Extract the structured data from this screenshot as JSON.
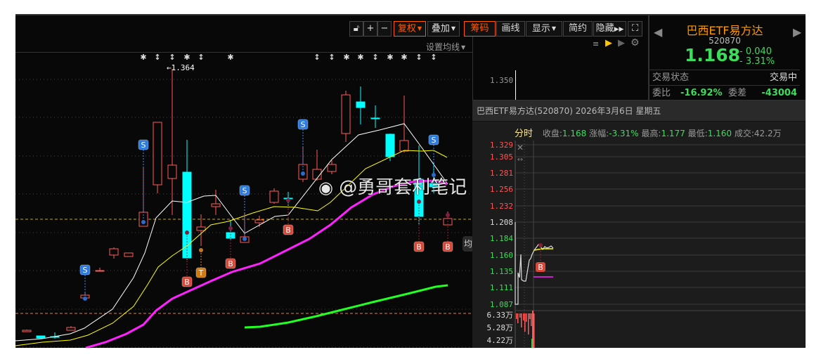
{
  "toolbar": {
    "plus": "+",
    "minus": "−",
    "fuquan": "复权",
    "diejia": "叠加",
    "chouma": "筹码",
    "huaxian": "画线",
    "xianshi": "显示",
    "jianyue": "简约",
    "yincang": "隐藏"
  },
  "chart": {
    "set_ma": "设置均线",
    "high_label": "1.364",
    "side_tab": "均",
    "watermark": "@勇哥套利笔记",
    "signal_s": "S",
    "signal_b": "B",
    "signal_t": "T"
  },
  "mid": {
    "price_label": "1.350"
  },
  "quote": {
    "name": "巴西ETF易方达",
    "code": "520870",
    "price": "1.168",
    "change": "- 0.040",
    "change_pct": "- 3.31%",
    "status_label": "交易状态",
    "status_value": "交易中",
    "weibi_label": "委比",
    "weibi_value": "-16.92%",
    "weicha_label": "委差",
    "weicha_value": "-43004"
  },
  "popup": {
    "title": "巴西ETF易方达(520870) 2026年3月6日 星期五",
    "tab": "分时",
    "close_label": "收盘:",
    "close": "1.168",
    "chg_label": "涨幅:",
    "chg": "-3.31%",
    "high_label": "最高:",
    "high": "1.177",
    "low_label": "最低:",
    "low": "1.160",
    "vol_label": "成交:",
    "vol": "42.2万",
    "price_ticks": [
      "1.329",
      "1.305",
      "1.281",
      "1.256",
      "1.232",
      "1.208",
      "1.184",
      "1.160",
      "1.135",
      "1.111",
      "1.087"
    ],
    "vol_ticks": [
      "6.33万",
      "5.28万",
      "4.22万"
    ],
    "marker": "B"
  },
  "colors": {
    "up": "#ff5a5a",
    "down": "#00ffff",
    "accent": "#ff5a00",
    "green": "#3ddc5c"
  }
}
